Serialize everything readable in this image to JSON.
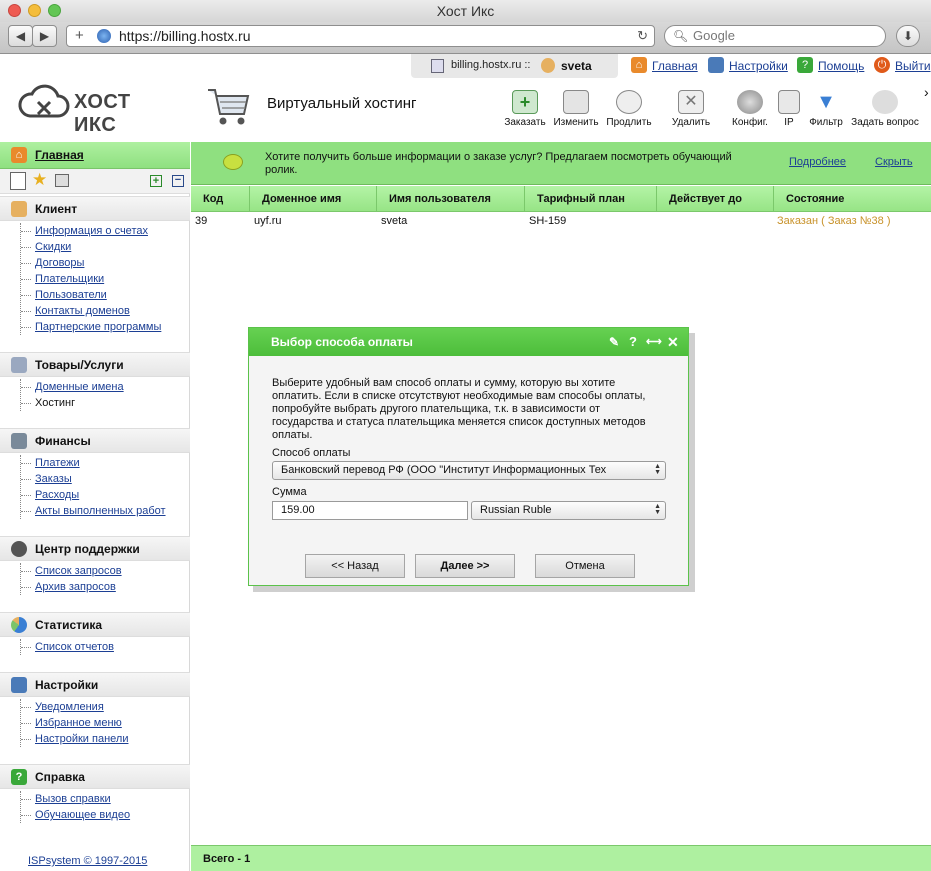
{
  "browser": {
    "title": "Хост Икс",
    "url": "https://billing.hostx.ru",
    "search_placeholder": "Google",
    "back_label": "◀",
    "fwd_label": "▶",
    "plus_label": "+",
    "reload_icon": "↻",
    "download_icon": "⬇"
  },
  "top": {
    "host": "billing.hostx.ru ::",
    "user": "sveta",
    "links": [
      "Главная",
      "Настройки",
      "Помощь",
      "Выйти"
    ]
  },
  "header": {
    "logo_text": "ХОСТ ИКС",
    "section_title": "Виртуальный хостинг",
    "actions": [
      "Заказать",
      "Изменить",
      "Продлить",
      "Удалить",
      "Конфиг.",
      "IP",
      "Фильтр",
      "Задать вопрос"
    ],
    "more": "›"
  },
  "sidebar": {
    "home_label": "Главная",
    "sections": [
      {
        "title": "Клиент",
        "items": [
          "Информация о счетах",
          "Скидки",
          "Договоры",
          "Плательщики",
          "Пользователи",
          "Контакты доменов",
          "Партнерские программы"
        ]
      },
      {
        "title": "Товары/Услуги",
        "items": [
          "Доменные имена",
          "Хостинг"
        ]
      },
      {
        "title": "Финансы",
        "items": [
          "Платежи",
          "Заказы",
          "Расходы",
          "Акты выполненных работ"
        ]
      },
      {
        "title": "Центр поддержки",
        "items": [
          "Список запросов",
          "Архив запросов"
        ]
      },
      {
        "title": "Статистика",
        "items": [
          "Список отчетов"
        ]
      },
      {
        "title": "Настройки",
        "items": [
          "Уведомления",
          "Избранное меню",
          "Настройки панели"
        ]
      },
      {
        "title": "Справка",
        "items": [
          "Вызов справки",
          "Обучающее видео"
        ]
      }
    ],
    "copyright": "ISPsystem © 1997-2015"
  },
  "banner": {
    "text": "Хотите получить больше информации о заказе услуг? Предлагаем посмотреть обучающий ролик.",
    "more": "Подробнее",
    "hide": "Скрыть"
  },
  "table": {
    "columns": [
      "Код",
      "Доменное имя",
      "Имя пользователя",
      "Тарифный план",
      "Действует до",
      "Состояние"
    ],
    "rows": [
      [
        "39",
        "uyf.ru",
        "sveta",
        "SH-159",
        "",
        "Заказан ( Заказ №38 )"
      ]
    ],
    "footer": "Всего - 1"
  },
  "dialog": {
    "title": "Выбор способа оплаты",
    "description": "Выберите удобный вам способ оплаты и сумму, которую вы хотите оплатить. Если в списке отсутствуют необходимые вам способы оплаты, попробуйте выбрать другого плательщика, т.к. в зависимости от государства и статуса плательщика меняется список доступных методов оплаты.",
    "method_label": "Способ оплаты",
    "method_value": "Банковский перевод РФ (ООО \"Институт Информационных Тех",
    "amount_label": "Сумма",
    "amount_value": "159.00",
    "currency_value": "Russian Ruble",
    "back_button": "<< Назад",
    "next_button": "Далее >>",
    "cancel_button": "Отмена"
  },
  "colors": {
    "accent_green": "#8fe080",
    "dialog_header": "#4cbd3a",
    "link_blue": "#1c3f94",
    "status_ordered": "#c8922a"
  }
}
